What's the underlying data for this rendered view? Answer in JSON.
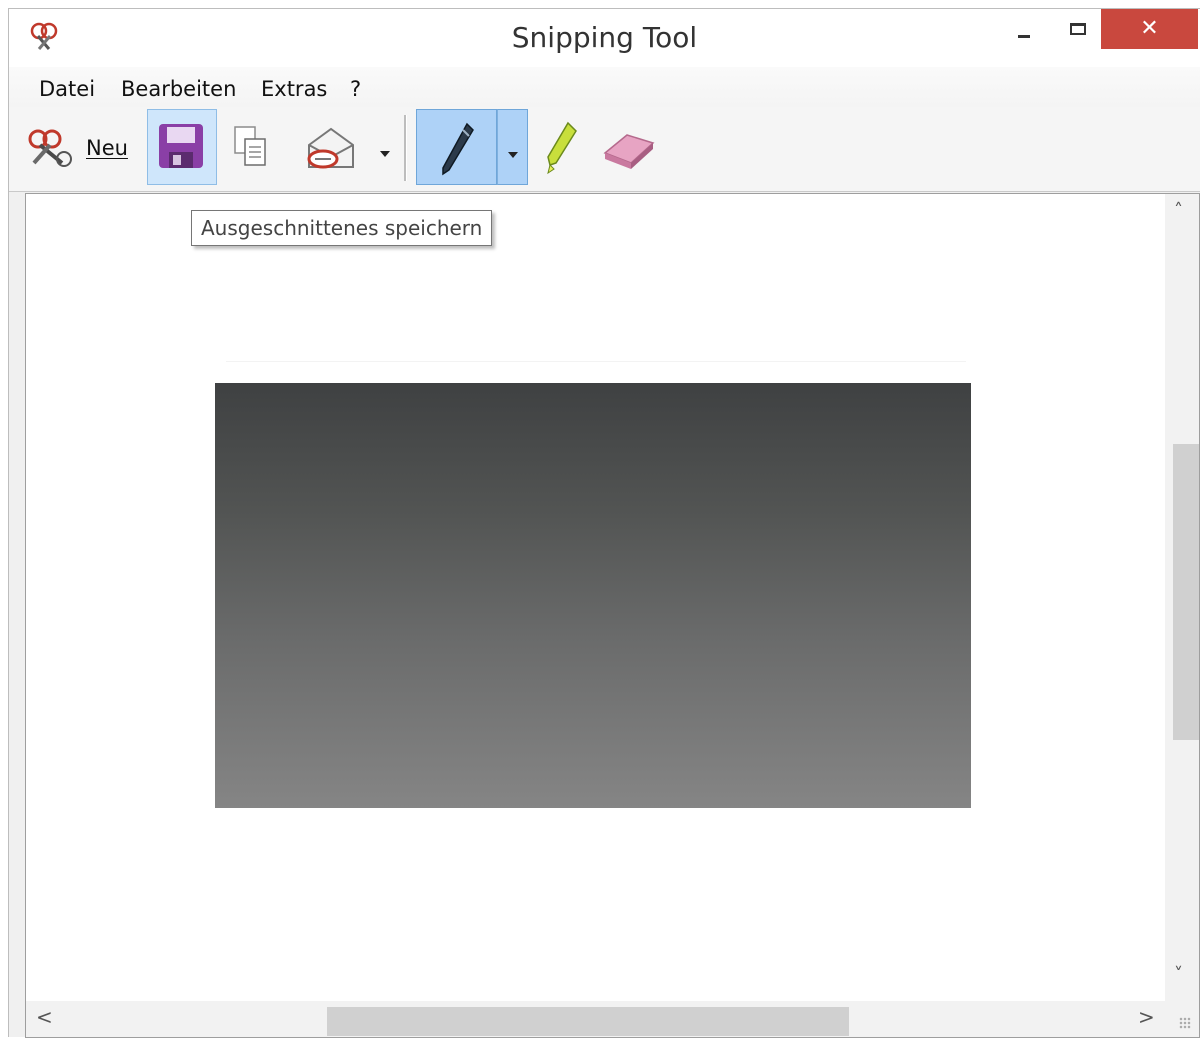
{
  "window": {
    "title": "Snipping Tool",
    "close_glyph": "✕",
    "icons": {
      "app": "scissors-app-icon",
      "minimize": "minimize-icon",
      "maximize": "maximize-icon",
      "close": "close-icon"
    }
  },
  "menu": {
    "items": [
      "Datei",
      "Bearbeiten",
      "Extras",
      "?"
    ]
  },
  "toolbar": {
    "new_label": "Neu",
    "icons": [
      "scissors-icon",
      "save-icon",
      "copy-icon",
      "send-email-icon",
      "dropdown-arrow-icon",
      "pen-icon",
      "dropdown-arrow-icon",
      "highlighter-icon",
      "eraser-icon"
    ],
    "tooltip": "Ausgeschnittenes speichern"
  },
  "scrollbars": {
    "up": "˄",
    "down": "˅",
    "left": "<",
    "right": ">"
  },
  "colors": {
    "close_button": "#c9483e",
    "pressed_button": "#aed2f7",
    "hover_button": "#cfe6fb",
    "save_icon": "#8a3fa6"
  }
}
